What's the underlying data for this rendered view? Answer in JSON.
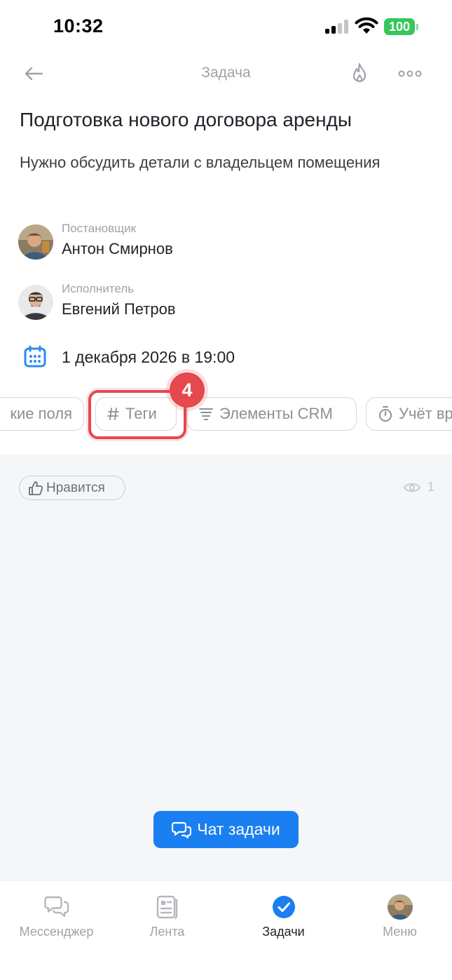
{
  "status_bar": {
    "time": "10:32",
    "battery": "100"
  },
  "header": {
    "title": "Задача"
  },
  "task": {
    "title": "Подготовка нового договора аренды",
    "description": "Нужно обсудить детали с владельцем помещения"
  },
  "creator": {
    "role": "Постановщик",
    "name": "Антон Смирнов"
  },
  "assignee": {
    "role": "Исполнитель",
    "name": "Евгений Петров"
  },
  "deadline": {
    "text": "1 декабря 2026 в 19:00"
  },
  "chips": {
    "fields": "кие поля",
    "tags": "Теги",
    "crm": "Элементы CRM",
    "time": "Учёт вр"
  },
  "step_badge": "4",
  "feed": {
    "like_label": "Нравится",
    "views_count": "1",
    "chat_button": "Чат задачи"
  },
  "tabbar": {
    "messenger": "Мессенджер",
    "feed": "Лента",
    "tasks": "Задачи",
    "menu": "Меню"
  },
  "colors": {
    "accent": "#1a7ff0",
    "highlight": "#e5484d",
    "battery": "#34c759"
  }
}
